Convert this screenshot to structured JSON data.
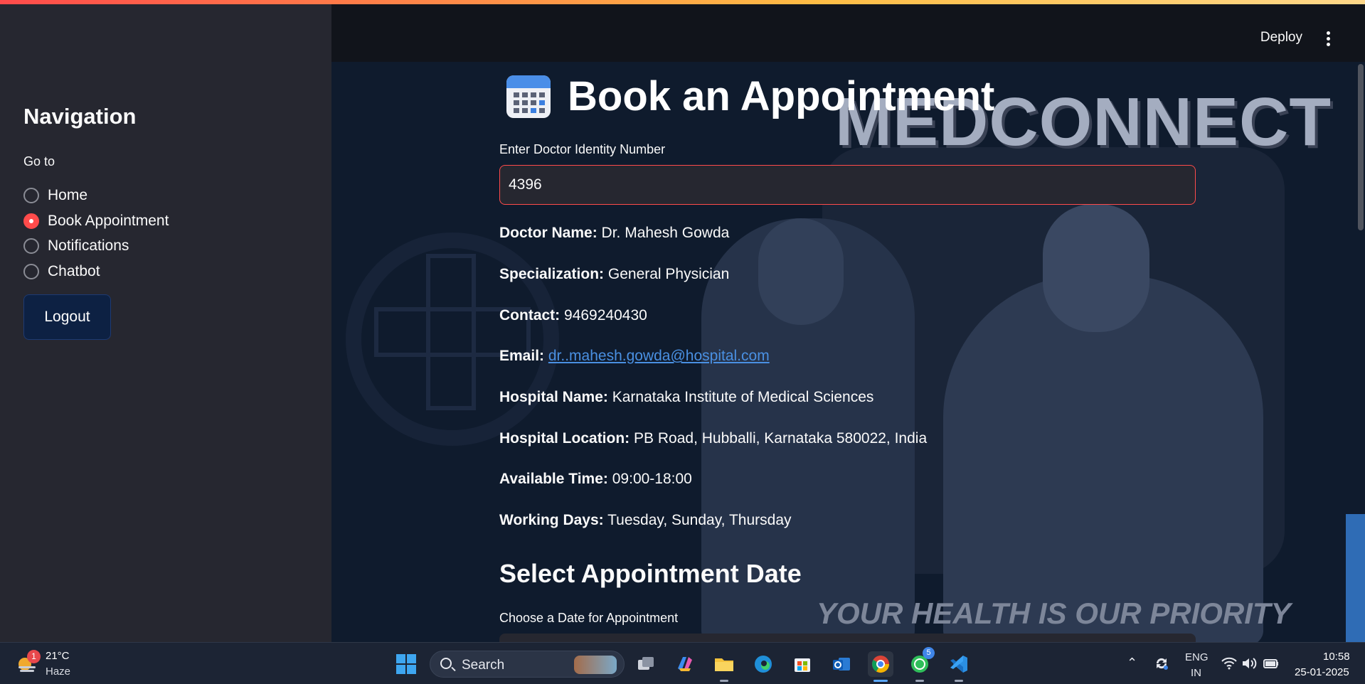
{
  "sidebar": {
    "title": "Navigation",
    "goto_label": "Go to",
    "options": [
      {
        "label": "Home",
        "selected": false
      },
      {
        "label": "Book Appointment",
        "selected": true
      },
      {
        "label": "Notifications",
        "selected": false
      },
      {
        "label": "Chatbot",
        "selected": false
      }
    ],
    "logout_label": "Logout"
  },
  "header": {
    "deploy_label": "Deploy",
    "menu_icon": "kebab-menu-icon"
  },
  "background": {
    "brand": "MEDCONNECT",
    "tagline": "YOUR HEALTH IS OUR PRIORITY"
  },
  "main": {
    "title": "Book an Appointment",
    "title_icon": "calendar-icon",
    "doctor_id_label": "Enter Doctor Identity Number",
    "doctor_id_value": "4396",
    "details": [
      {
        "key": "Doctor Name:",
        "value": "Dr. Mahesh Gowda"
      },
      {
        "key": "Specialization:",
        "value": "General Physician"
      },
      {
        "key": "Contact:",
        "value": "9469240430"
      },
      {
        "key": "Email:",
        "value": "dr..mahesh.gowda@hospital.com"
      },
      {
        "key": "Hospital Name:",
        "value": "Karnataka Institute of Medical Sciences"
      },
      {
        "key": "Hospital Location:",
        "value": "PB Road, Hubballi, Karnataka 580022, India"
      },
      {
        "key": "Available Time:",
        "value": "09:00-18:00"
      },
      {
        "key": "Working Days:",
        "value": "Tuesday, Sunday, Thursday"
      }
    ],
    "date_section_title": "Select Appointment Date",
    "date_label": "Choose a Date for Appointment"
  },
  "taskbar": {
    "weather_temp": "21°C",
    "weather_desc": "Haze",
    "weather_badge": "1",
    "search_label": "Search",
    "whatsapp_badge": "5",
    "lang_line1": "ENG",
    "lang_line2": "IN",
    "time": "10:58",
    "date": "25-01-2025"
  },
  "colors": {
    "accent": "#ff4b4b",
    "sidebar_bg": "#262730",
    "link": "#4a90e2",
    "logout_bg": "#0d2143"
  }
}
